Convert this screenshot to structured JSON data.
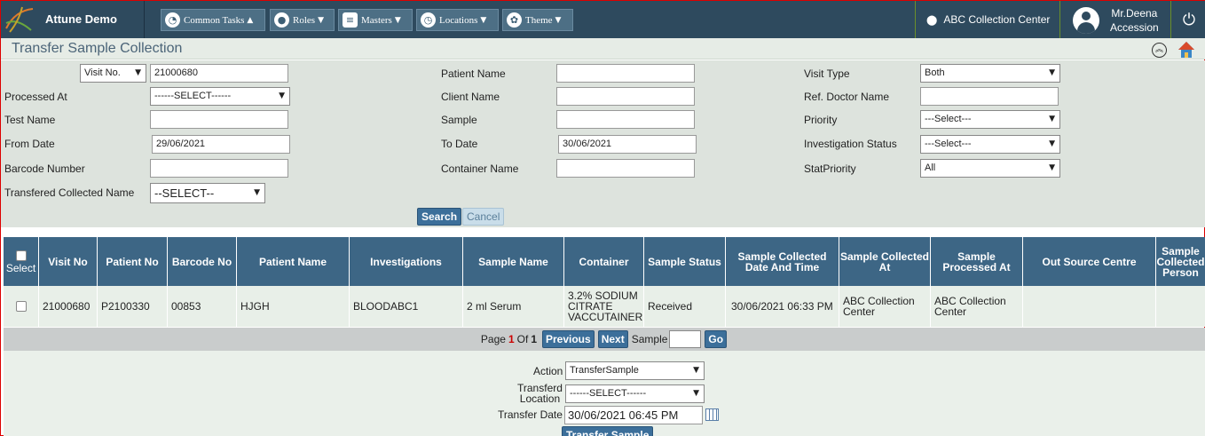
{
  "header": {
    "app_name": "Attune Demo",
    "nav": [
      {
        "label": "Common Tasks",
        "icon": "dashboard-icon"
      },
      {
        "label": "Roles",
        "icon": "user-circle-icon"
      },
      {
        "label": "Masters",
        "icon": "database-icon"
      },
      {
        "label": "Locations",
        "icon": "clock-icon"
      },
      {
        "label": "Theme",
        "icon": "palette-icon"
      }
    ],
    "location": "ABC Collection Center",
    "user_name": "Mr.Deena",
    "user_role": "Accession"
  },
  "page_title": "Transfer Sample Collection",
  "filters": {
    "search_by": "Visit No.",
    "visit_no": "21000680",
    "processed_at_label": "Processed At",
    "processed_at": "------SELECT------",
    "test_name_label": "Test Name",
    "test_name": "",
    "from_date_label": "From Date",
    "from_date": "29/06/2021",
    "barcode_label": "Barcode Number",
    "barcode": "",
    "transfered_label": "Transfered Collected Name",
    "transfered": "--SELECT--",
    "patient_name_label": "Patient Name",
    "client_name_label": "Client Name",
    "sample_label": "Sample",
    "to_date_label": "To Date",
    "to_date": "30/06/2021",
    "container_label": "Container Name",
    "visit_type_label": "Visit Type",
    "visit_type": "Both",
    "ref_doctor_label": "Ref. Doctor Name",
    "priority_label": "Priority",
    "priority": "---Select---",
    "inv_status_label": "Investigation Status",
    "inv_status": "---Select---",
    "stat_priority_label": "StatPriority",
    "stat_priority": "All",
    "search_btn": "Search",
    "cancel_btn": "Cancel"
  },
  "table": {
    "columns": [
      "Select",
      "Visit No",
      "Patient No",
      "Barcode No",
      "Patient Name",
      "Investigations",
      "Sample Name",
      "Container",
      "Sample Status",
      "Sample Collected Date And Time",
      "Sample Collected At",
      "Sample Processed At",
      "Out Source Centre",
      "Sample Collected Person"
    ],
    "rows": [
      [
        "",
        "21000680",
        "P2100330",
        "00853",
        "HJGH",
        "BLOODABC1",
        "2 ml Serum",
        "3.2% SODIUM CITRATE VACCUTAINER",
        "Received",
        "30/06/2021 06:33 PM",
        "ABC Collection Center",
        "ABC Collection Center",
        "",
        ""
      ]
    ]
  },
  "pager": {
    "page_word": "Page",
    "current": "1",
    "of_word": "Of",
    "total": "1",
    "prev": "Previous",
    "next": "Next",
    "sample_word": "Sample",
    "go": "Go"
  },
  "action_panel": {
    "action_label": "Action",
    "action": "TransferSample",
    "location_label_1": "Transferd",
    "location_label_2": "Location",
    "location": "------SELECT------",
    "date_label": "Transfer Date",
    "date": "30/06/2021 06:45 PM",
    "submit": "Transfer Sample"
  }
}
